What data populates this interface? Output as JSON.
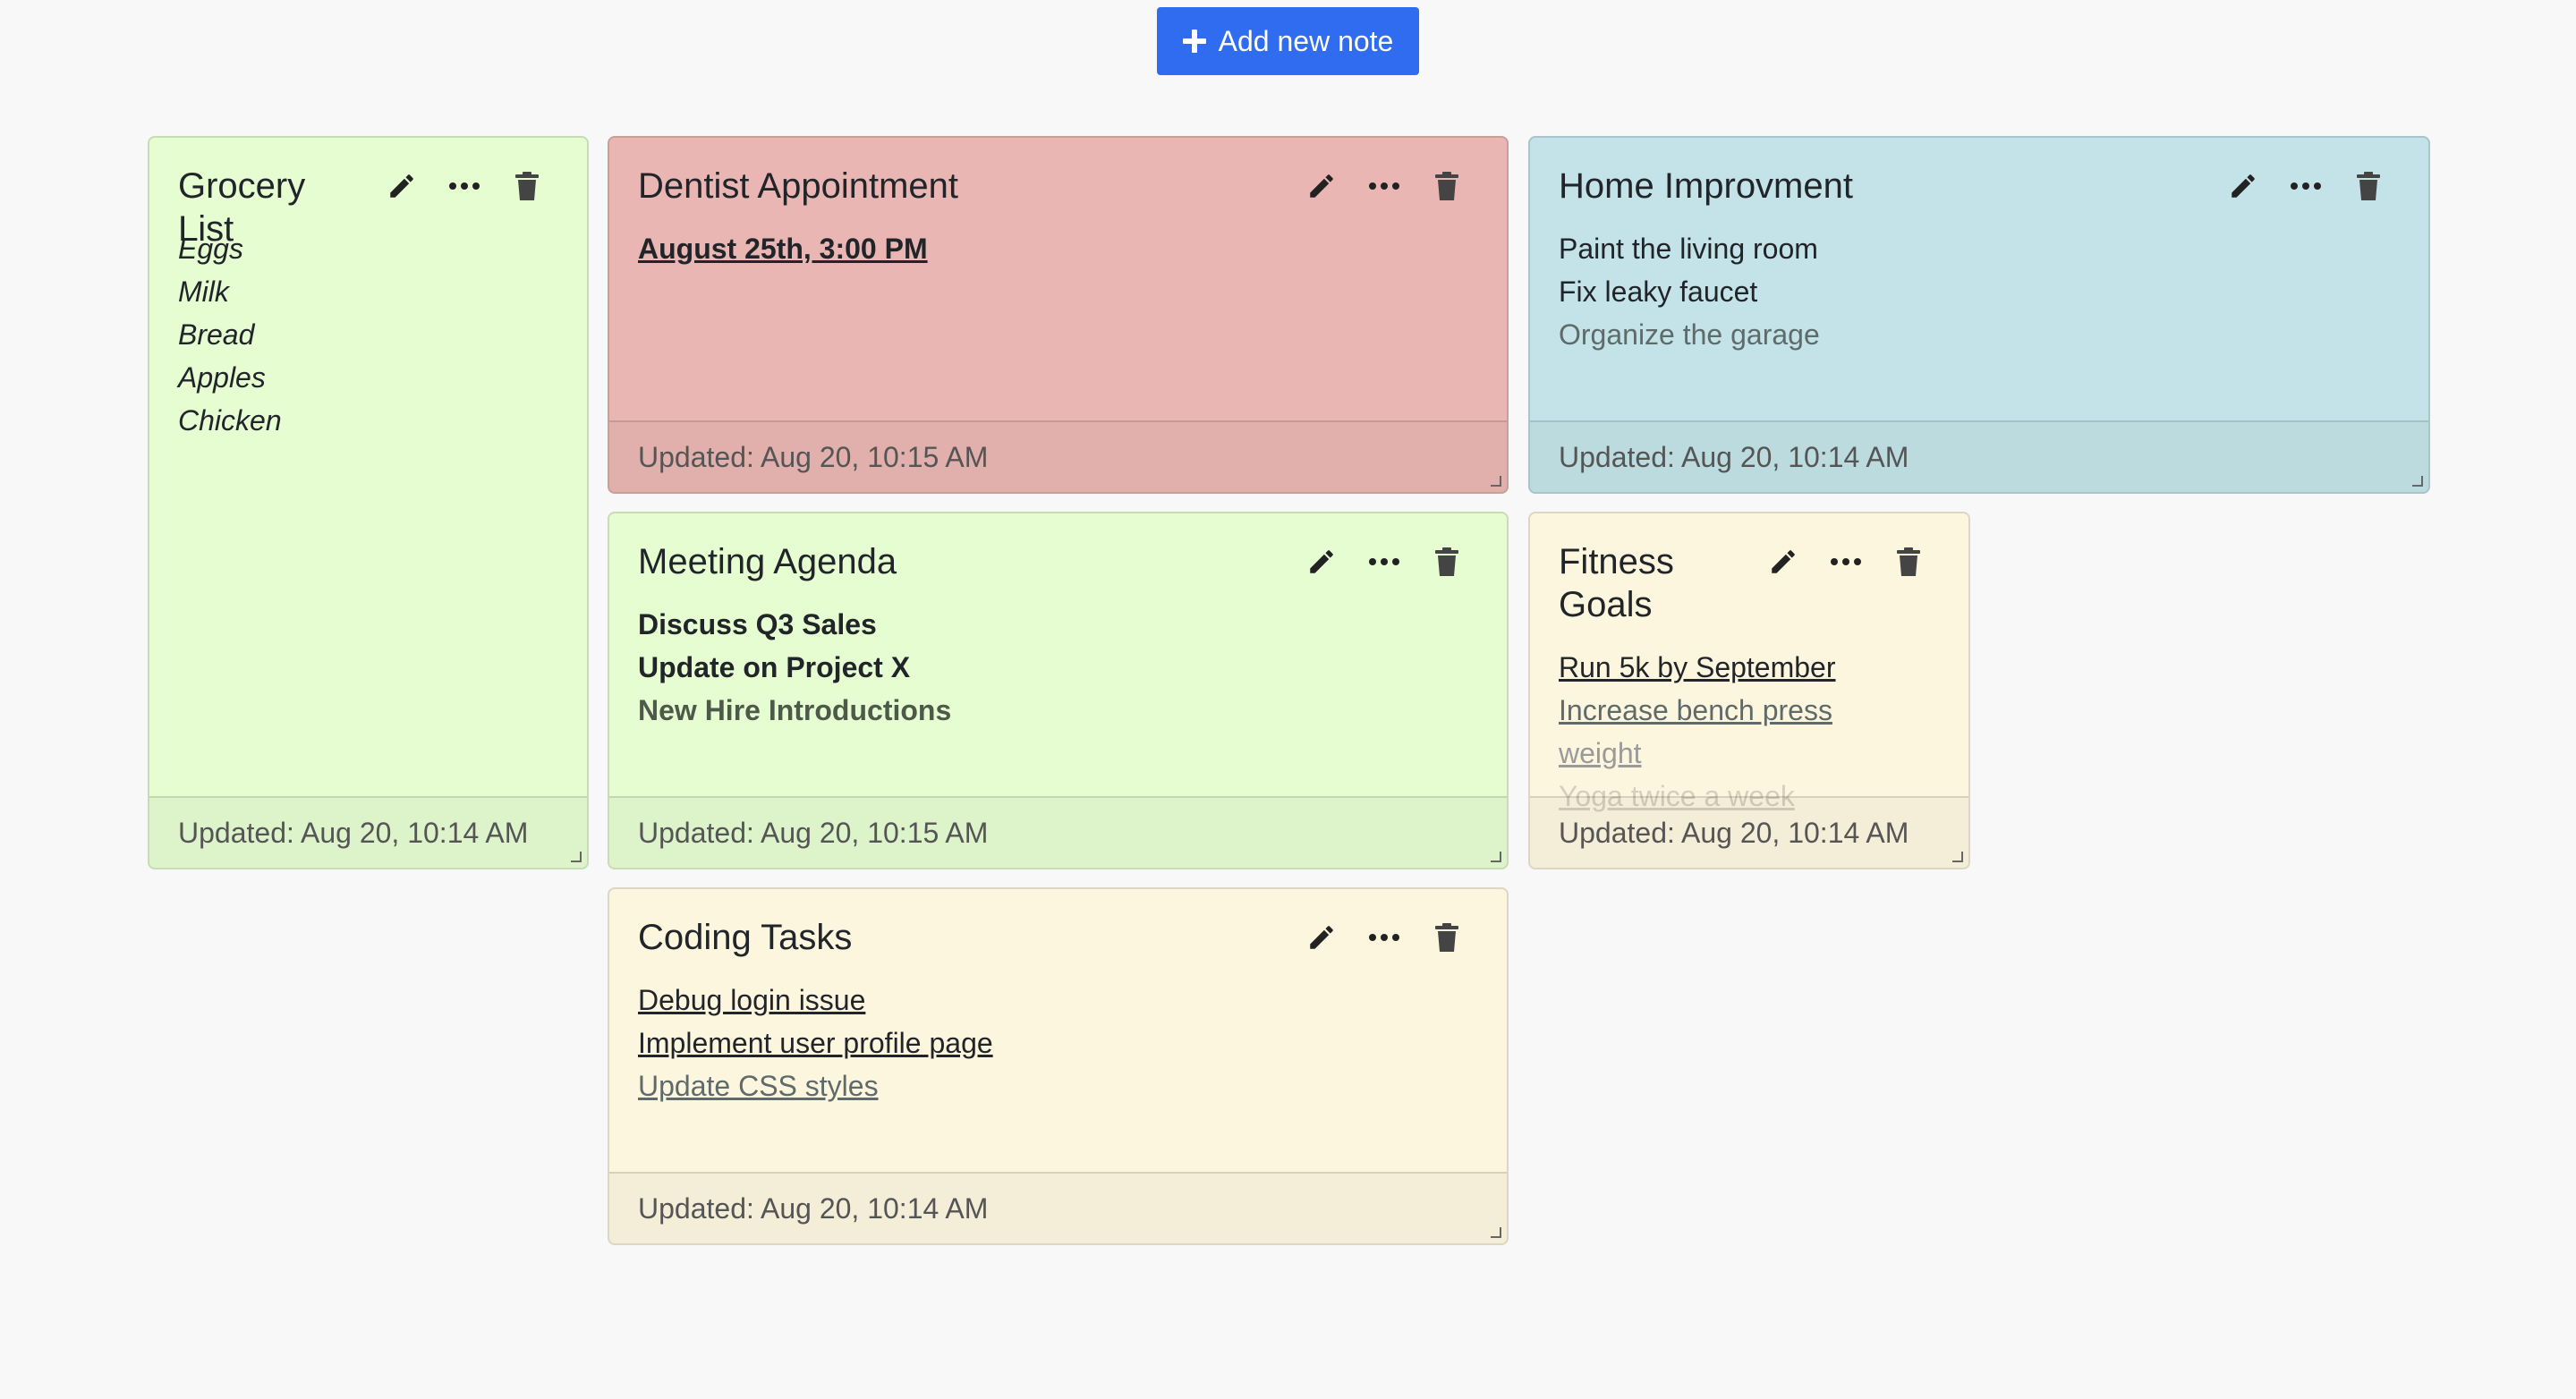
{
  "toolbar": {
    "add_label": "Add new note"
  },
  "icons": {
    "edit": "pencil-icon",
    "more": "ellipsis-icon",
    "delete": "trash-icon",
    "add": "plus-icon"
  },
  "colors": {
    "accent": "#2f6cf0",
    "green": "#e6fdd2",
    "red": "#eab6b3",
    "blue": "#c3e3e8",
    "yellow": "#fdf6df"
  },
  "notes": [
    {
      "title": "Grocery List",
      "items": [
        "Eggs",
        "Milk",
        "Bread",
        "Apples",
        "Chicken"
      ],
      "updated": "Updated: Aug 20, 10:14 AM"
    },
    {
      "title": "Dentist Appointment",
      "items": [
        "August 25th, 3:00 PM"
      ],
      "updated": "Updated: Aug 20, 10:15 AM"
    },
    {
      "title": "Home Improvment",
      "items": [
        "Paint the living room",
        "Fix leaky faucet",
        "Organize the garage"
      ],
      "updated": "Updated: Aug 20, 10:14 AM"
    },
    {
      "title": "Meeting Agenda",
      "items": [
        "Discuss Q3 Sales",
        "Update on Project X",
        "New Hire Introductions"
      ],
      "updated": "Updated: Aug 20, 10:15 AM"
    },
    {
      "title": "Fitness Goals",
      "title_lines": [
        "Fitness",
        "Goals"
      ],
      "items": [
        "Run 5k by September",
        "Increase bench press",
        "weight",
        "Yoga twice a week"
      ],
      "updated": "Updated: Aug 20, 10:14 AM"
    },
    {
      "title": "Coding Tasks",
      "items": [
        "Debug login issue",
        "Implement user profile page",
        "Update CSS styles"
      ],
      "updated": "Updated: Aug 20, 10:14 AM"
    }
  ]
}
